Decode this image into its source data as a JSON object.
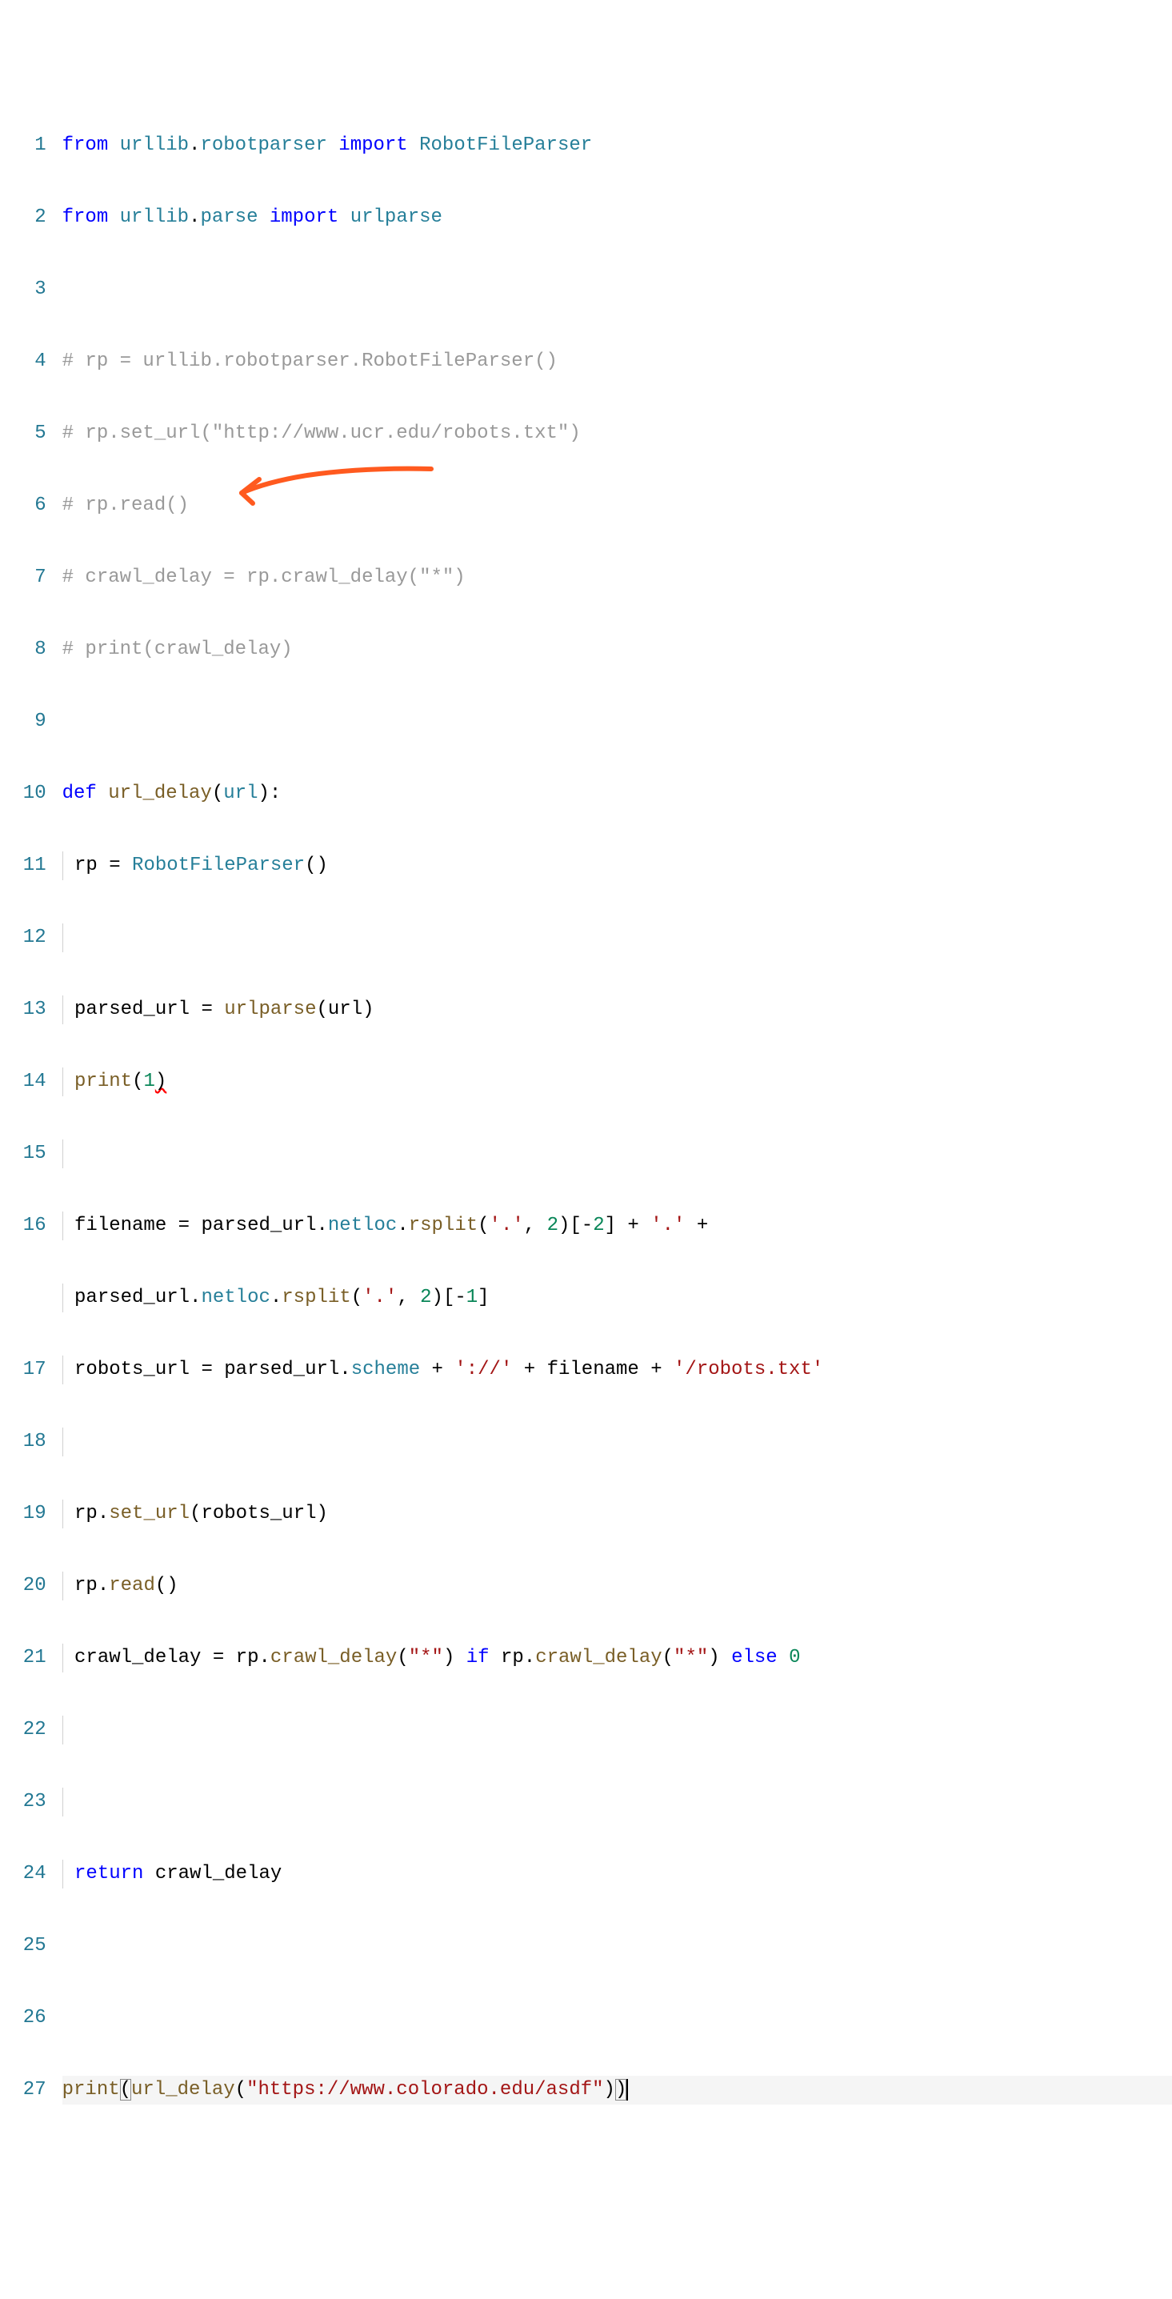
{
  "lines": {
    "1": {
      "from1": "from",
      "mod1": "urllib",
      "dot1": ".",
      "mod2": "robotparser",
      "imp": "import",
      "cls": "RobotFileParser"
    },
    "2": {
      "from1": "from",
      "mod1": "urllib",
      "dot1": ".",
      "mod2": "parse",
      "imp": "import",
      "cls": "urlparse"
    },
    "4": "# rp = urllib.robotparser.RobotFileParser()",
    "5": "# rp.set_url(\"http://www.ucr.edu/robots.txt\")",
    "6": "# rp.read()",
    "7": "# crawl_delay = rp.crawl_delay(\"*\")",
    "8": "# print(crawl_delay)",
    "10": {
      "def": "def",
      "name": "url_delay",
      "lp": "(",
      "param": "url",
      "rp": "):"
    },
    "11": {
      "var": "rp",
      "eq": " = ",
      "cls": "RobotFileParser",
      "paren": "()"
    },
    "13": {
      "var": "parsed_url",
      "eq": " = ",
      "fn": "urlparse",
      "lp": "(",
      "arg": "url",
      "rp": ")"
    },
    "14": {
      "fn": "print",
      "lp": "(",
      "num": "1",
      "rp": ")"
    },
    "16a": {
      "var": "filename",
      "eq": " = ",
      "obj": "parsed_url",
      "dot": ".",
      "attr": "netloc",
      "dot2": ".",
      "method": "rsplit",
      "lp": "(",
      "s1": "'.'",
      "c1": ", ",
      "n1": "2",
      "rp": ")[-",
      "n2": "2",
      "rb": "] + ",
      "s2": "'.'",
      "plus": " + "
    },
    "16b": {
      "obj": "parsed_url",
      "dot": ".",
      "attr": "netloc",
      "dot2": ".",
      "method": "rsplit",
      "lp": "(",
      "s1": "'.'",
      "c1": ", ",
      "n1": "2",
      "rp": ")[-",
      "n2": "1",
      "rb": "]"
    },
    "17": {
      "var": "robots_url",
      "eq": " = ",
      "obj": "parsed_url",
      "dot": ".",
      "attr": "scheme",
      "plus1": " + ",
      "s1": "'://'",
      "plus2": " + ",
      "v2": "filename",
      "plus3": " + ",
      "s2": "'/robots.txt'"
    },
    "19": {
      "obj": "rp",
      "dot": ".",
      "method": "set_url",
      "lp": "(",
      "arg": "robots_url",
      "rp": ")"
    },
    "20": {
      "obj": "rp",
      "dot": ".",
      "method": "read",
      "paren": "()"
    },
    "21": {
      "var": "crawl_delay",
      "eq": " = ",
      "obj1": "rp",
      "dot1": ".",
      "method1": "crawl_delay",
      "lp1": "(",
      "s1": "\"*\"",
      "rp1": ") ",
      "if": "if",
      "sp1": " ",
      "obj2": "rp",
      "dot2": ".",
      "method2": "crawl_delay",
      "lp2": "(",
      "s2": "\"*\"",
      "rp2": ") ",
      "else": "else",
      "sp2": " ",
      "n": "0"
    },
    "24": {
      "kw": "return",
      "sp": " ",
      "var": "crawl_delay"
    },
    "27": {
      "fn": "print",
      "lp": "(",
      "fn2": "url_delay",
      "lp2": "(",
      "s": "\"https://www.colorado.edu/asdf\"",
      "rp2": ")",
      "rp": ")"
    }
  },
  "line_numbers": [
    "1",
    "2",
    "3",
    "4",
    "5",
    "6",
    "7",
    "8",
    "9",
    "10",
    "11",
    "12",
    "13",
    "14",
    "15",
    "16",
    "",
    "17",
    "18",
    "19",
    "20",
    "21",
    "22",
    "23",
    "24",
    "25",
    "26",
    "27"
  ]
}
